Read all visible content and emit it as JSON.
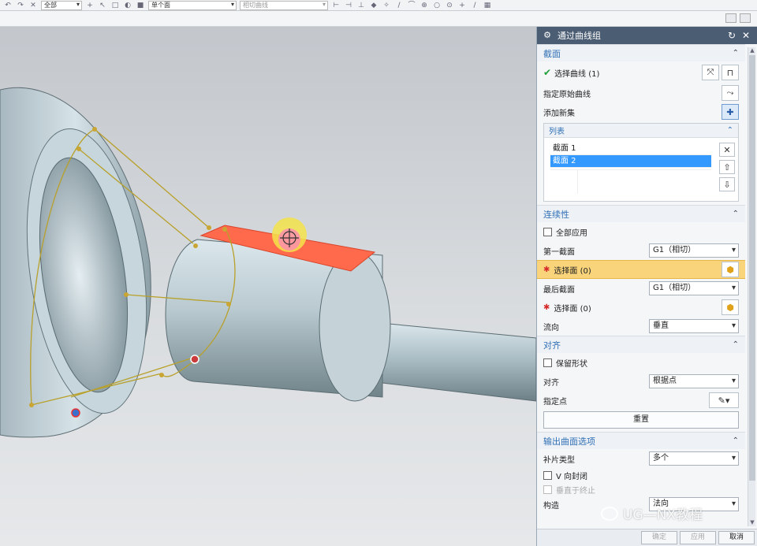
{
  "toolbar": {
    "filter_select": "全部",
    "face_rule_select": "单个面",
    "curve_rule_select": "相切曲线"
  },
  "dialog": {
    "title": "通过曲线组",
    "sections": {
      "section": {
        "title": "截面",
        "select_curve": "选择曲线 (1)",
        "specify_origin": "指定原始曲线",
        "add_new_set": "添加新集",
        "list_title": "列表",
        "list_items": [
          "截面 1",
          "截面 2"
        ]
      },
      "continuity": {
        "title": "连续性",
        "apply_all": "全部应用",
        "first_section": "第一截面",
        "first_value": "G1（相切）",
        "select_face_first": "选择面 (0)",
        "last_section": "最后截面",
        "last_value": "G1（相切）",
        "select_face_last": "选择面 (0)",
        "flow_dir": "流向",
        "flow_value": "垂直"
      },
      "alignment": {
        "title": "对齐",
        "keep_shape": "保留形状",
        "align": "对齐",
        "align_value": "根据点",
        "specify_point": "指定点",
        "reset": "重置"
      },
      "output": {
        "title": "输出曲面选项",
        "patch_type": "补片类型",
        "patch_value": "多个",
        "v_closed": "V 向封闭",
        "normal_to_end": "垂直于终止",
        "construction": "构造",
        "construction_value": "法向"
      }
    },
    "footer": {
      "ok": "确定",
      "apply": "应用",
      "cancel": "取消"
    }
  },
  "watermark": "UG—NX教程",
  "colors": {
    "title_bar": "#4b5d72",
    "section_text": "#2f6fb5",
    "highlight_row": "#f9d47a",
    "list_selected": "#3399ff",
    "selected_face": "#ff6a4d"
  }
}
